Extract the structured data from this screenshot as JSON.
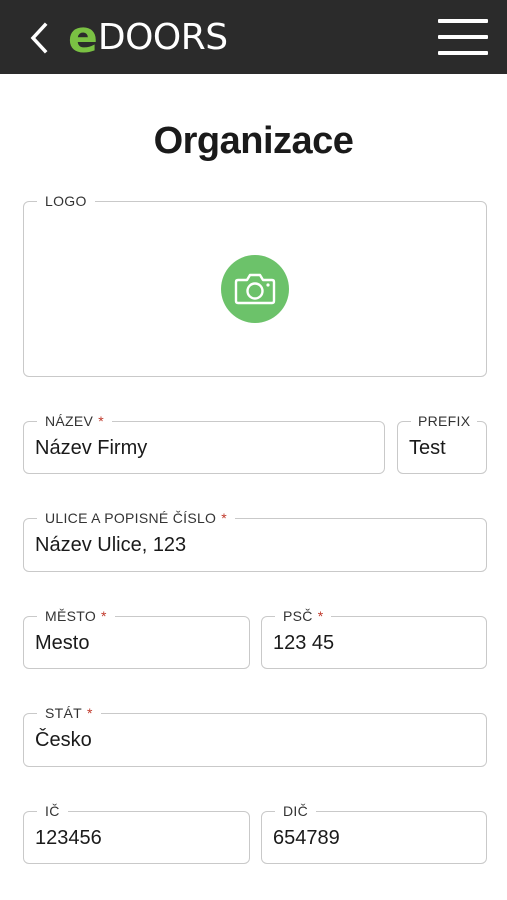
{
  "header": {
    "logo_e": "e",
    "logo_rest": "DOORS",
    "accent_color": "#7ac143",
    "back_icon": "chevron-left-icon",
    "menu_icon": "hamburger-menu-icon"
  },
  "page": {
    "title": "Organizace"
  },
  "logo_field": {
    "label": "LOGO",
    "icon": "camera-icon",
    "button_color": "#6cc26a"
  },
  "fields": {
    "name": {
      "label": "NÁZEV",
      "value": "Název Firmy",
      "required": "*"
    },
    "prefix": {
      "label": "PREFIX",
      "value": "Test"
    },
    "street": {
      "label": "ULICE A POPISNÉ ČÍSLO",
      "value": "Název Ulice, 123",
      "required": "*"
    },
    "city": {
      "label": "MĚSTO",
      "value": "Mesto",
      "required": "*"
    },
    "zip": {
      "label": "PSČ",
      "value": "123 45",
      "required": "*"
    },
    "country": {
      "label": "STÁT",
      "value": "Česko",
      "required": "*"
    },
    "ic": {
      "label": "IČ",
      "value": "123456"
    },
    "dic": {
      "label": "DIČ",
      "value": "654789"
    }
  }
}
